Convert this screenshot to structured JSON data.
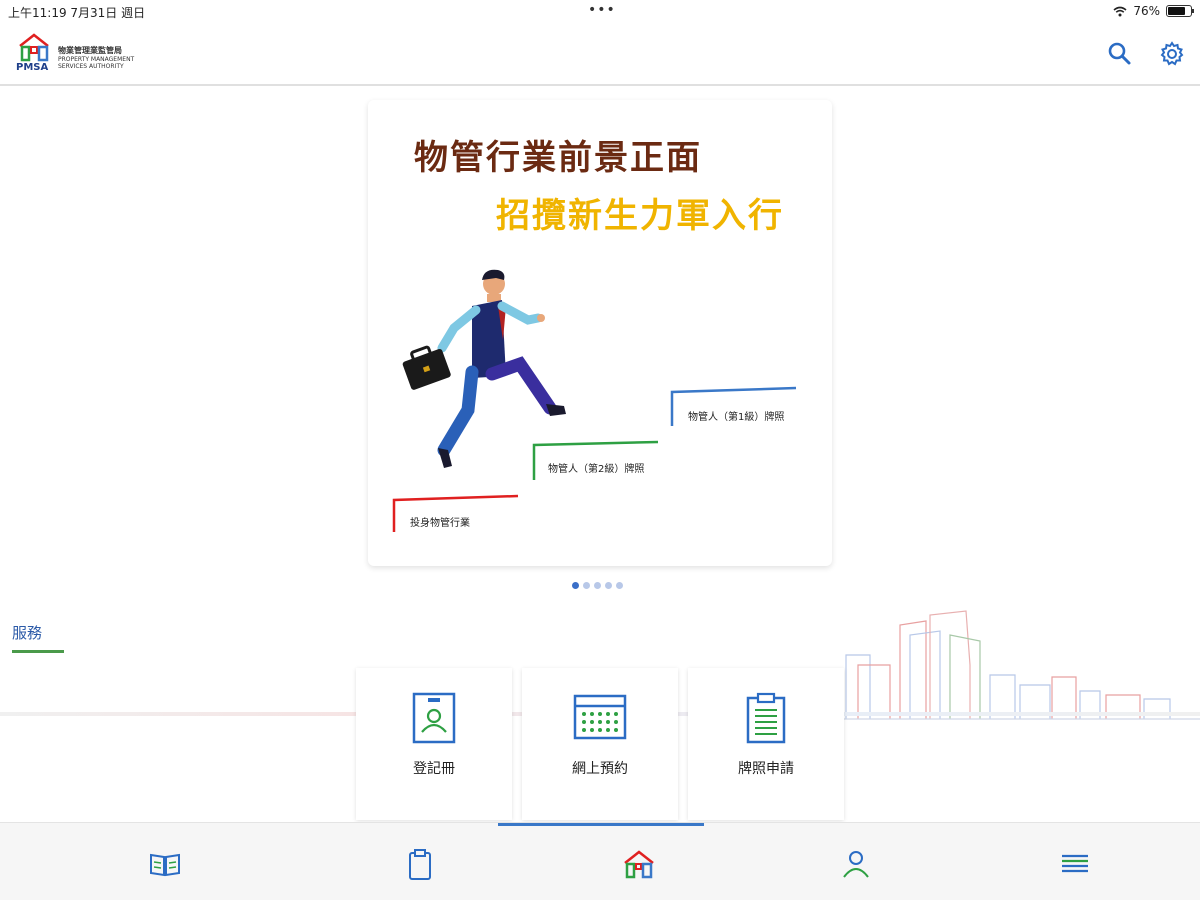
{
  "status_bar": {
    "time_date": "上午11:19   7月31日 週日",
    "battery_percent": "76%",
    "battery_level": 0.76
  },
  "header": {
    "logo_abbr": "PMSA",
    "logo_name_zh": "物業管理業監管局",
    "logo_name_en": "PROPERTY MANAGEMENT SERVICES AUTHORITY",
    "icons": [
      "search-icon",
      "settings-gear-icon"
    ]
  },
  "banner": {
    "headline_1": "物管行業前景正面",
    "headline_2": "招攬新生力軍入行",
    "steps": [
      {
        "label": "投身物管行業",
        "color": "#e02020"
      },
      {
        "label": "物管人（第2級）牌照",
        "color": "#2ea043"
      },
      {
        "label": "物管人（第1級）牌照",
        "color": "#3a78c8"
      }
    ],
    "colors": {
      "headline_1": "#6b2a12",
      "headline_2": "#f0b400"
    }
  },
  "pager": {
    "count": 5,
    "active_index": 0
  },
  "services": {
    "title": "服務",
    "items": [
      {
        "label": "登記冊",
        "icon": "register-card-icon"
      },
      {
        "label": "網上預約",
        "icon": "calendar-icon"
      },
      {
        "label": "牌照申請",
        "icon": "clipboard-icon"
      }
    ]
  },
  "bottom_nav": {
    "items": [
      "book-icon",
      "clipboard-icon",
      "home-icon",
      "person-icon",
      "menu-icon"
    ],
    "active_index": 2,
    "accent": "#3a78c8"
  }
}
